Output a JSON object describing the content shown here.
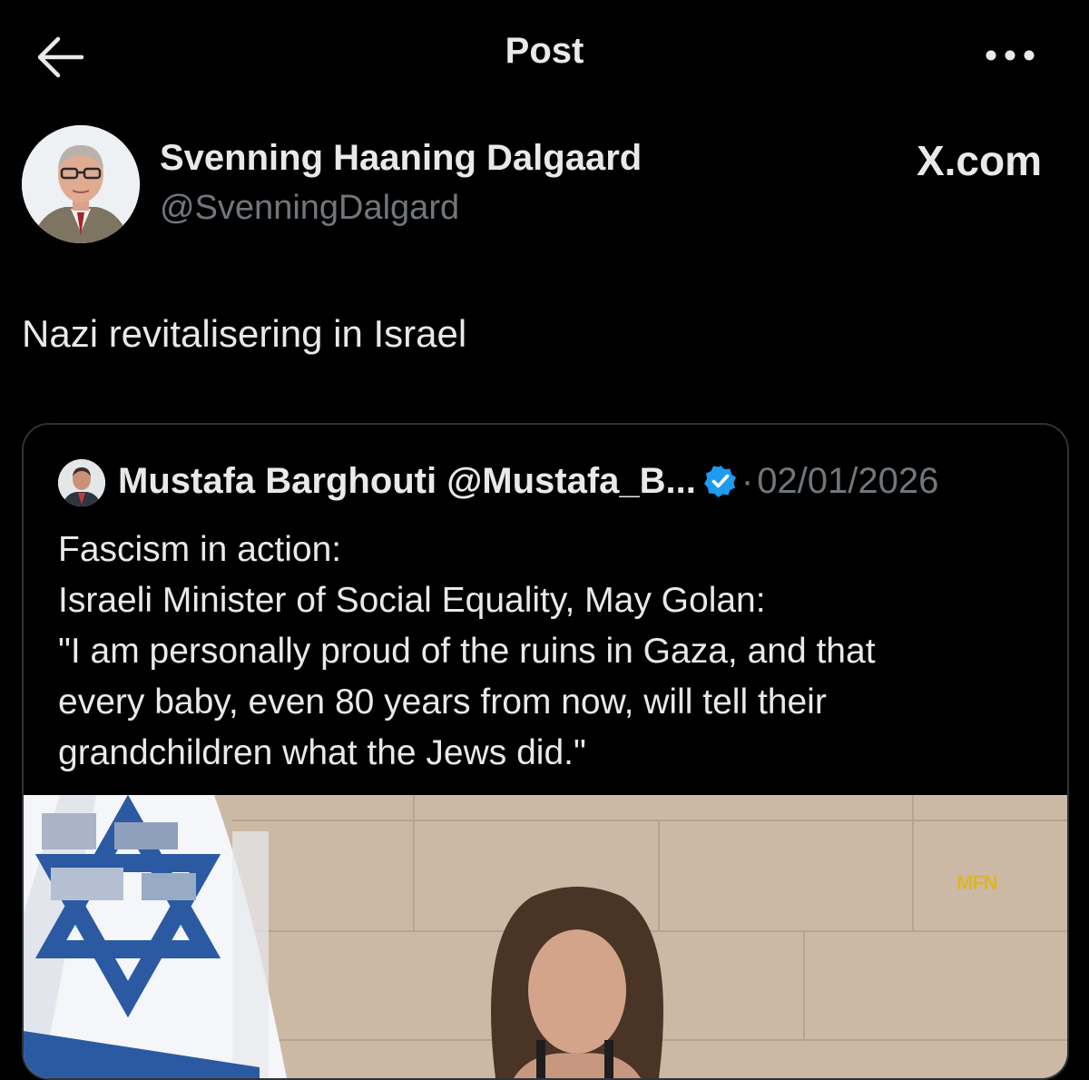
{
  "header": {
    "back_icon": "arrow-left-icon",
    "title": "Post",
    "more_icon": "more-horizontal-icon"
  },
  "post": {
    "author_name": "Svenning Haaning Dalgaard",
    "author_handle": "@SvenningDalgard",
    "site_label": "X.com",
    "text": "Nazi revitalisering in Israel"
  },
  "quote": {
    "author_name": "Mustafa Barghouti",
    "author_handle": "@Mustafa_B...",
    "verified_icon": "verified-badge-icon",
    "separator": "·",
    "date": "02/01/2026",
    "lines": [
      "Fascism in action:",
      "Israeli Minister of Social Equality, May Golan:",
      "\"I am personally proud of the ruins in Gaza, and that",
      "every baby, even 80 years from now, will tell their",
      "grandchildren what the Jews did.\""
    ],
    "media_watermark": "MFN"
  },
  "colors": {
    "background": "#000000",
    "text_primary": "#e7e9ea",
    "text_secondary": "#71767b",
    "border": "#2f3336",
    "verified": "#1d9bf0"
  }
}
